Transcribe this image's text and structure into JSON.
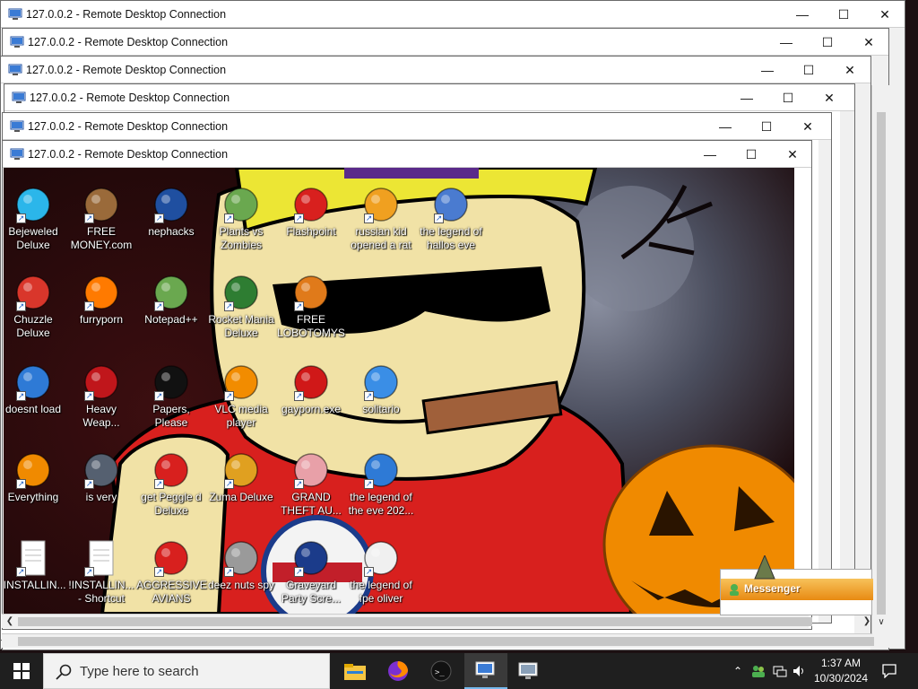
{
  "rdp_windows": [
    {
      "title": "127.0.0.2 - Remote Desktop Connection"
    },
    {
      "title": "127.0.0.2 - Remote Desktop Connection"
    },
    {
      "title": "127.0.0.2 - Remote Desktop Connection"
    },
    {
      "title": "127.0.0.2 - Remote Desktop Connection"
    },
    {
      "title": "127.0.0.2 - Remote Desktop Connection"
    },
    {
      "title": "127.0.0.2 - Remote Desktop Connection"
    }
  ],
  "window_controls": {
    "minimize": "—",
    "maximize": "☐",
    "close": "✕"
  },
  "desktop_icons": [
    {
      "label": "Bejeweled Deluxe",
      "icon": "gem-icon"
    },
    {
      "label": "FREE MONEY.com",
      "icon": "money-bag-icon"
    },
    {
      "label": "nephacks",
      "icon": "mpi-logo-icon"
    },
    {
      "label": "Plants vs Zombies",
      "icon": "flower-icon"
    },
    {
      "label": "Flashpoint",
      "icon": "flashpoint-icon"
    },
    {
      "label": "russian kid opened a rat",
      "icon": "de-logo-icon"
    },
    {
      "label": "the legend of hallos eve",
      "icon": "shield-folder-icon"
    },
    {
      "label": "Chuzzle Deluxe",
      "icon": "chuzzle-icon"
    },
    {
      "label": "furryporn",
      "icon": "firefox-icon"
    },
    {
      "label": "Notepad++",
      "icon": "notepad-icon"
    },
    {
      "label": "Rocket Mania Deluxe",
      "icon": "rocket-icon"
    },
    {
      "label": "FREE LOBOTOMYS",
      "icon": "gauge-icon"
    },
    {
      "label": "doesnt load",
      "icon": "thunderbird-icon"
    },
    {
      "label": "Heavy Weap...",
      "icon": "radiation-icon"
    },
    {
      "label": "Papers, Please",
      "icon": "black-circle-icon"
    },
    {
      "label": "VLC media player",
      "icon": "vlc-cone-icon"
    },
    {
      "label": "gayporn.exe",
      "icon": "flash-player-icon"
    },
    {
      "label": "solitario",
      "icon": "installer-icon"
    },
    {
      "label": "Everything",
      "icon": "magnifier-icon"
    },
    {
      "label": "is very",
      "icon": "mpi-shield-icon"
    },
    {
      "label": "get Peggle d Deluxe",
      "icon": "peggle-icon"
    },
    {
      "label": "Zuma Deluxe",
      "icon": "zuma-icon"
    },
    {
      "label": "GRAND THEFT AU...",
      "icon": "anime-girl-icon"
    },
    {
      "label": "the legend of the eve 202...",
      "icon": "thunderbird-icon"
    },
    {
      "label": "!INSTALLIN...",
      "icon": "text-file-icon"
    },
    {
      "label": "!INSTALLIN... - Shortcut",
      "icon": "text-file-icon"
    },
    {
      "label": "AGGRESSIVE AVIANS",
      "icon": "angry-bird-icon"
    },
    {
      "label": "deez nuts spy",
      "icon": "windows-stack-icon"
    },
    {
      "label": "Graveyard Party Scre...",
      "icon": "vote-badge-icon"
    },
    {
      "label": "the legend of fpe oliver",
      "icon": "pixel-cat-icon"
    }
  ],
  "messenger": {
    "title": "Messenger"
  },
  "taskbar": {
    "search_placeholder": "Type here to search",
    "apps": [
      "file-explorer-icon",
      "firefox-icon",
      "terminal-icon",
      "remote-desktop-icon",
      "remote-desktop-icon"
    ],
    "time": "1:37 AM",
    "date": "10/30/2024"
  },
  "colors": {
    "taskbar_bg": "#1f1f1f",
    "titlebar_bg": "#ffffff",
    "messenger_header": "#e88a12",
    "pumpkin": "#f08a00",
    "hero_shirt": "#d8201e"
  }
}
